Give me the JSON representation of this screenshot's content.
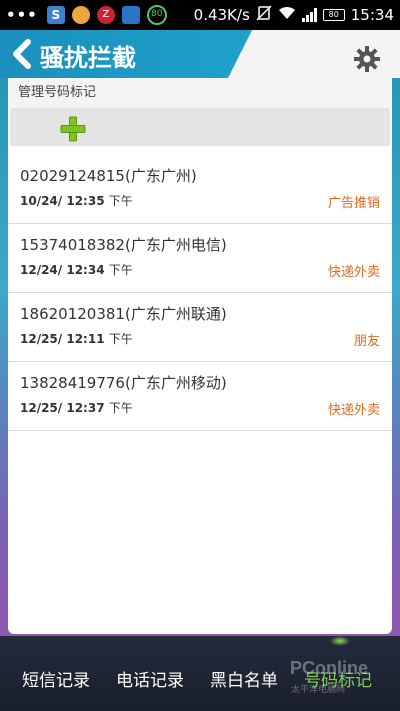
{
  "status_bar": {
    "dots": "•••",
    "network_speed": "0.43K/s",
    "battery": "80",
    "time": "15:34",
    "badge_80": "80"
  },
  "header": {
    "title": "骚扰拦截"
  },
  "subheader": {
    "label": "管理号码标记"
  },
  "records": [
    {
      "number": "02029124815(广东广州)",
      "date": "10/24/ 12:35",
      "ampm": "下午",
      "tag": "广告推销"
    },
    {
      "number": "15374018382(广东广州电信)",
      "date": "12/24/ 12:34",
      "ampm": "下午",
      "tag": "快递外卖"
    },
    {
      "number": "18620120381(广东广州联通)",
      "date": "12/25/ 12:11",
      "ampm": "下午",
      "tag": "朋友"
    },
    {
      "number": "13828419776(广东广州移动)",
      "date": "12/25/ 12:37",
      "ampm": "下午",
      "tag": "快递外卖"
    }
  ],
  "tabs": [
    {
      "label": "短信记录"
    },
    {
      "label": "电话记录"
    },
    {
      "label": "黑白名单"
    },
    {
      "label": "号码标记"
    }
  ],
  "watermark": {
    "brand": "PConline",
    "sub": "太平洋电脑网"
  },
  "colors": {
    "accent": "#1ea0c8",
    "tag": "#e06a1c",
    "active_tab": "#7fd05a",
    "plus": "#7cc520"
  }
}
